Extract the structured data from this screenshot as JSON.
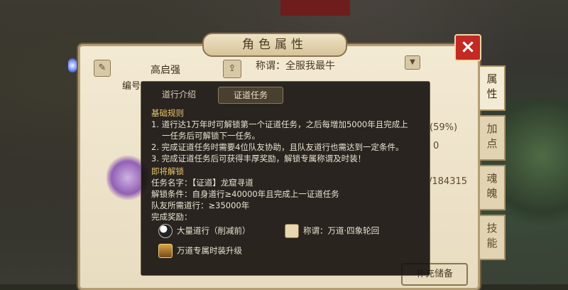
{
  "scene": {
    "top_text": ""
  },
  "panel": {
    "title": "角色属性",
    "close_label": "×",
    "side_tabs": [
      "属性",
      "加点",
      "魂魄",
      "技能"
    ],
    "character_name": "高启强",
    "id_label": "编号",
    "title_text": "称谓：全服我最牛",
    "fragments": {
      "f1": "(59%)",
      "f2": "0",
      "f3": "/184315"
    },
    "reserve_button": "补充储备"
  },
  "tooltip": {
    "tabs": [
      "道行介绍",
      "证道任务"
    ],
    "active_tab": "证道任务",
    "rules_heading": "基础规则",
    "rules": [
      "1. 道行达1万年时可解锁第一个证道任务，之后每增加5000年且完成上",
      "一任务后可解锁下一任务。",
      "2. 完成证道任务时需要4位队友协助，且队友道行也需达到一定条件。",
      "3. 完成证道任务后可获得丰厚奖励，解锁专属称谓及时装！"
    ],
    "unlock_heading": "即将解锁",
    "task_name": "任务名字：【证道】龙窟寻道",
    "unlock_cond": "解锁条件：自身道行≥40000年且完成上一证道任务",
    "team_req": "队友所需道行：≥35000年",
    "reward_label": "完成奖励：",
    "rewards": [
      {
        "icon": "yin-yang-icon",
        "text": "大量道行（削减前）"
      },
      {
        "icon": "title-card-icon",
        "text": "称谓：万道·四象轮回"
      },
      {
        "icon": "outfit-icon",
        "text": "万道专属时装升级"
      }
    ]
  }
}
